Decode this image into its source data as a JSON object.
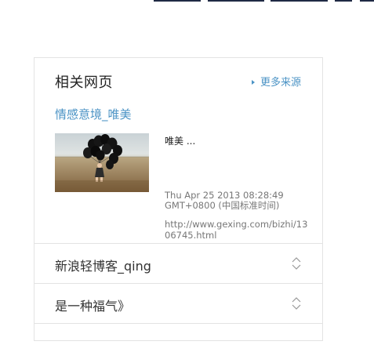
{
  "related": {
    "title": "相关网页",
    "more_label": "更多来源",
    "result": {
      "title": "情感意境_唯美",
      "snippet": "唯美 ...",
      "date": "Thu Apr 25 2013 08:28:49 GMT+0800 (中国标准时间)",
      "url": "http://www.gexing.com/bizhi/1306745.html"
    },
    "items": [
      {
        "label": "新浪轻博客_qing"
      },
      {
        "label": "是一种福气》"
      }
    ]
  },
  "colors": {
    "link": "#4b93c5",
    "border": "#e3e3e3",
    "top_bar": "#1f2a44"
  },
  "icons": {
    "more": "triangle-right-icon",
    "row_toggle": "expand-collapse-icon"
  }
}
